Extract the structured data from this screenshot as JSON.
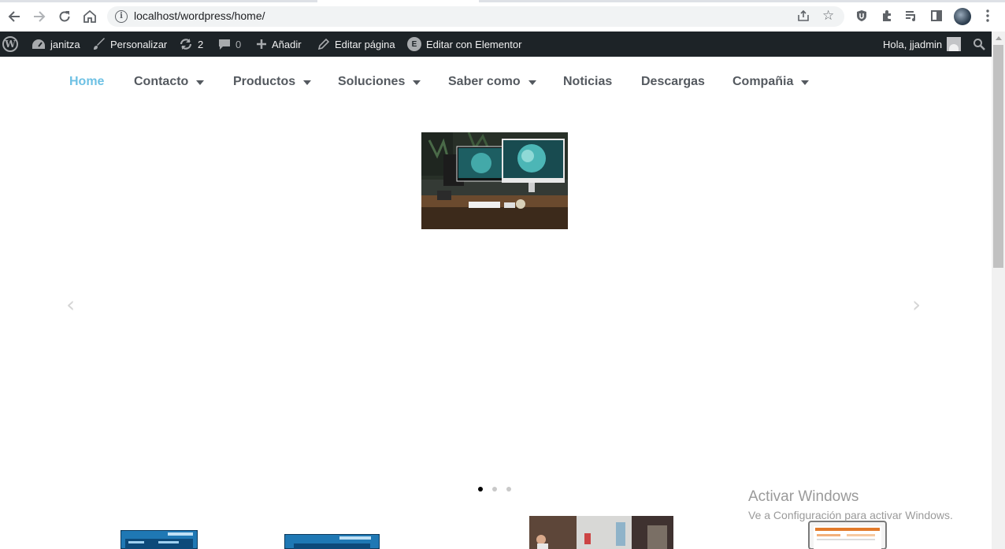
{
  "browser": {
    "url": "localhost/wordpress/home/"
  },
  "adminbar": {
    "site_name": "janitza",
    "customize": "Personalizar",
    "updates_count": "2",
    "comments_count": "0",
    "add_new": "Añadir",
    "edit_page": "Editar página",
    "edit_elementor": "Editar con Elementor",
    "greeting": "Hola, jjadmin"
  },
  "menu": {
    "items": [
      {
        "label": "Home",
        "active": true,
        "has_submenu": false
      },
      {
        "label": "Contacto",
        "active": false,
        "has_submenu": true
      },
      {
        "label": "Productos",
        "active": false,
        "has_submenu": true
      },
      {
        "label": "Soluciones",
        "active": false,
        "has_submenu": true
      },
      {
        "label": "Saber como",
        "active": false,
        "has_submenu": true
      },
      {
        "label": "Noticias",
        "active": false,
        "has_submenu": false
      },
      {
        "label": "Descargas",
        "active": false,
        "has_submenu": false
      },
      {
        "label": "Compañia",
        "active": false,
        "has_submenu": true
      }
    ],
    "active_color": "#6ec1e4",
    "text_color": "#54595f"
  },
  "slider": {
    "prev": "‹",
    "next": "›",
    "current_slide": 1,
    "slide_count": 3
  },
  "watermark": {
    "title": "Activar Windows",
    "subtitle": "Ve a Configuración para activar Windows."
  }
}
